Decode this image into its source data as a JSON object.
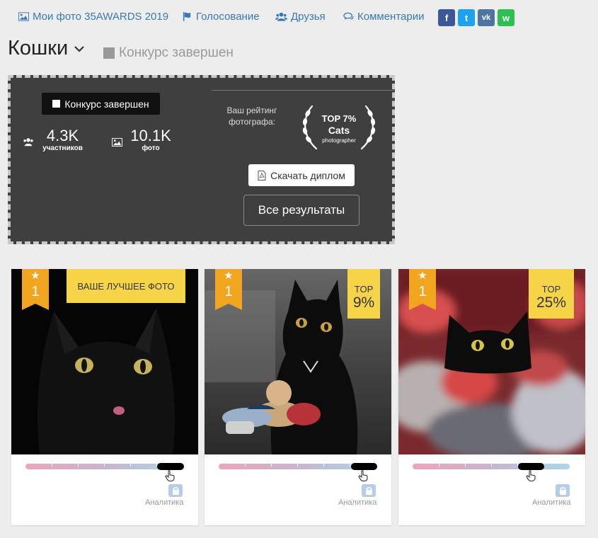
{
  "nav": {
    "my_photos": "Мои фото 35AWARDS 2019",
    "voting": "Голосование",
    "friends": "Друзья",
    "comments": "Комментарии"
  },
  "social": {
    "fb": "f",
    "tw": "t",
    "vk": "vk",
    "wa": "w"
  },
  "header": {
    "title": "Кошки",
    "status": "Конкурс завершен"
  },
  "panel": {
    "badge": "Конкурс завершен",
    "participants_value": "4.3K",
    "participants_label": "участников",
    "photos_value": "10.1K",
    "photos_label": "фото",
    "rating_label": "Ваш рейтинг фотографа:",
    "laurel_top": "TOP 7%",
    "laurel_category": "Cats",
    "laurel_sub": "photographer",
    "diploma_button": "Скачать диплом",
    "results_button": "Все результаты"
  },
  "colors": {
    "accent_link": "#3a78b5",
    "ribbon": "#f2a51e",
    "badge_yellow": "#f5d547",
    "panel_bg": "#3f3f3f"
  },
  "cards": [
    {
      "rank_star": "★",
      "rank": "1",
      "badge": "ВАШЕ ЛУЧШЕЕ ФОТО",
      "analytics": "Аналитика"
    },
    {
      "rank_star": "★",
      "rank": "1",
      "badge_top": "TOP",
      "badge_value": "9%",
      "analytics": "Аналитика"
    },
    {
      "rank_star": "★",
      "rank": "1",
      "badge_top": "TOP",
      "badge_value": "25%",
      "analytics": "Аналитика"
    }
  ]
}
